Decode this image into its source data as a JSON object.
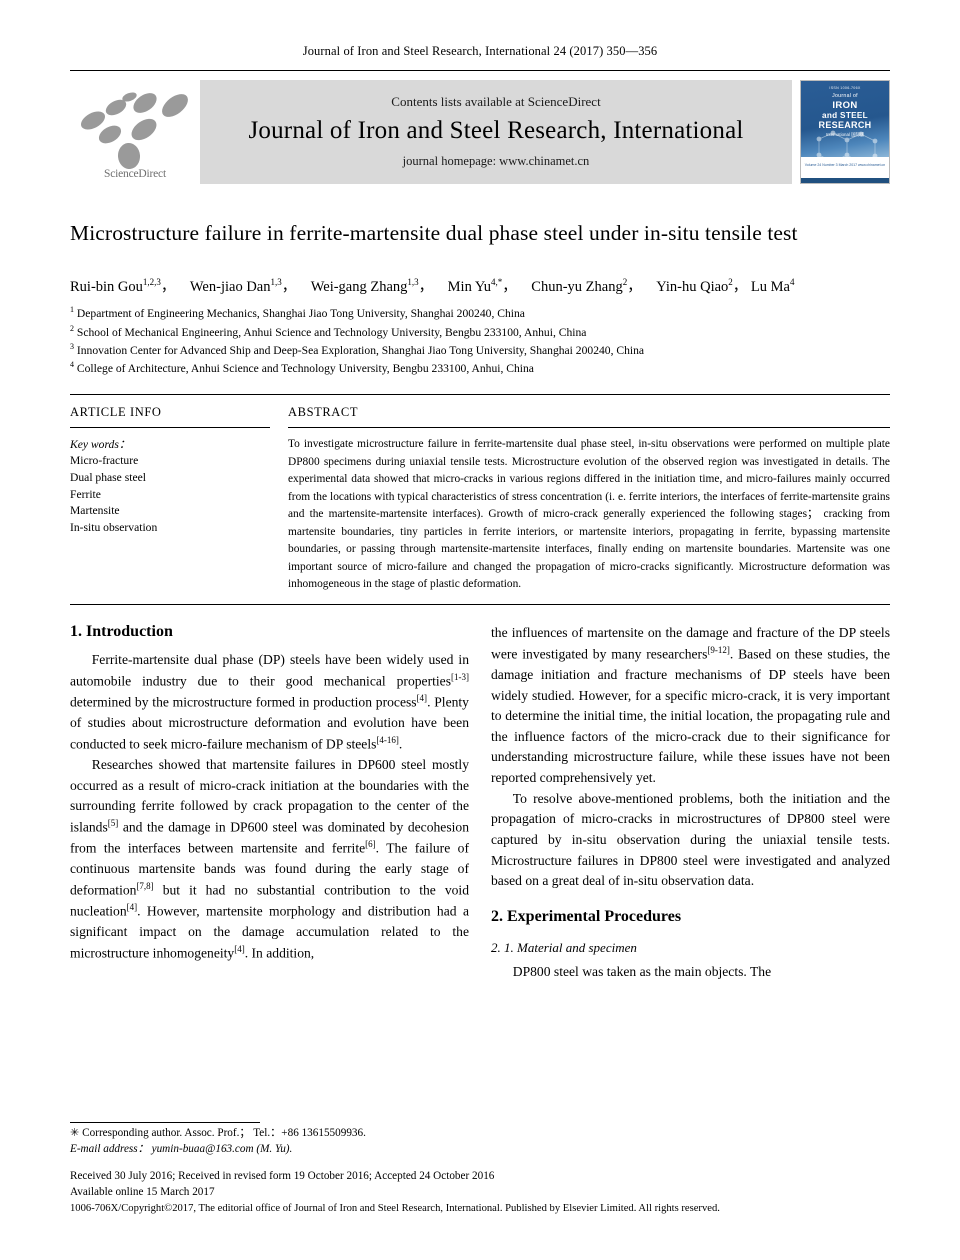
{
  "running_head": "Journal of Iron and Steel Research, International 24 (2017) 350—356",
  "masthead": {
    "sciencedirect_label": "ScienceDirect",
    "contents_line": "Contents lists available at ScienceDirect",
    "journal_title": "Journal of Iron and Steel Research, International",
    "homepage_line": "journal homepage: www.chinamet.cn",
    "cover": {
      "top_tiny": "ISSN 1006-706X",
      "journal_word": "Journal of",
      "iron": "IRON",
      "and_steel": "and STEEL",
      "research": "RESEARCH",
      "international": "International\n国际版",
      "badge": "Available online at\nwww.sciencedirect.com",
      "white_text": "Volume 24  Number 3  March 2017\nwww.chinamet.cn"
    }
  },
  "article": {
    "title": "Microstructure failure in ferrite-martensite dual phase steel under in-situ tensile test",
    "authors_html": "Rui-bin Gou<sup>1,2,3</sup>， Wen-jiao Dan<sup>1,3</sup>， Wei-gang Zhang<sup>1,3</sup>， Min Yu<sup>4,*</sup>， Chun-yu Zhang<sup>2</sup>， Yin-hu Qiao<sup>2</sup>， Lu Ma<sup>4</sup>",
    "affiliations": [
      "1 Department of Engineering Mechanics, Shanghai Jiao Tong University, Shanghai 200240, China",
      "2 School of Mechanical Engineering, Anhui Science and Technology University, Bengbu 233100, Anhui, China",
      "3 Innovation Center for Advanced Ship and Deep-Sea Exploration, Shanghai Jiao Tong University, Shanghai 200240, China",
      "4 College of Architecture, Anhui Science and Technology University, Bengbu 233100, Anhui, China"
    ]
  },
  "article_info": {
    "heading": "ARTICLE INFO",
    "keywords_label": "Key words：",
    "keywords": [
      "Micro-fracture",
      "Dual phase steel",
      "Ferrite",
      "Martensite",
      "In-situ observation"
    ]
  },
  "abstract": {
    "heading": "ABSTRACT",
    "text": "To investigate microstructure failure in ferrite-martensite dual phase steel, in-situ observations were performed on multiple plate DP800 specimens during uniaxial tensile tests. Microstructure evolution of the observed region was investigated in details. The experimental data showed that micro-cracks in various regions differed in the initiation time, and micro-failures mainly occurred from the locations with typical characteristics of stress concentration (i. e. ferrite interiors, the interfaces of ferrite-martensite grains and the martensite-martensite interfaces). Growth of micro-crack generally experienced the following stages； cracking from martensite boundaries, tiny particles in ferrite interiors, or martensite interiors, propagating in ferrite, bypassing martensite boundaries, or passing through martensite-martensite interfaces, finally ending on martensite boundaries. Martensite was one important source of micro-failure and changed the propagation of micro-cracks significantly. Microstructure deformation was inhomogeneous in the stage of plastic deformation."
  },
  "body": {
    "section1_heading": "1. Introduction",
    "col1_para1_html": "Ferrite-martensite dual phase (DP) steels have been widely used in automobile industry due to their good mechanical properties<sup>[1-3]</sup> determined by the microstructure formed in production process<sup>[4]</sup>. Plenty of studies about microstructure deformation and evolution have been conducted to seek micro-failure mechanism of DP steels<sup>[4-16]</sup>.",
    "col1_para2_html": "Researches showed that martensite failures in DP600 steel mostly occurred as a result of micro-crack initiation at the boundaries with the surrounding ferrite followed by crack propagation to the center of the islands<sup>[5]</sup> and the damage in DP600 steel was dominated by decohesion from the interfaces between martensite and ferrite<sup>[6]</sup>. The failure of continuous martensite bands was found during the early stage of deformation<sup>[7,8]</sup> but it had no substantial contribution to the void nucleation<sup>[4]</sup>. However, martensite morphology and distribution had a significant impact on the damage accumulation related to the microstructure inhomogeneity<sup>[4]</sup>. In addition,",
    "col2_para1_html": "the influences of martensite on the damage and fracture of the DP steels were investigated by many researchers<sup>[9-12]</sup>. Based on these studies, the damage initiation and fracture mechanisms of DP steels have been widely studied. However, for a specific micro-crack, it is very important to determine the initial time, the initial location, the propagating rule and the influence factors of the micro-crack due to their significance for understanding microstructure failure, while these issues have not been reported comprehensively yet.",
    "col2_para2_html": "To resolve above-mentioned problems, both the initiation and the propagation of micro-cracks in microstructures of DP800 steel were captured by in-situ observation during the uniaxial tensile tests. Microstructure failures in DP800 steel were investigated and analyzed based on a great deal of in-situ observation data.",
    "section2_heading": "2. Experimental Procedures",
    "subsection21_heading": "2. 1. Material and specimen",
    "col2_para3_html": "DP800 steel was taken as the main objects. The"
  },
  "footer": {
    "corresponding_author": "✳ Corresponding author. Assoc. Prof.； Tel.：+86 13615509936.",
    "email_line": "E-mail address： yumin-buaa@163.com (M. Yu).",
    "history": "Received 30 July 2016; Received in revised form 19 October 2016; Accepted 24 October 2016",
    "available_online": "Available online 15 March 2017",
    "copyright": "1006-706X/Copyright©2017, The editorial office of Journal of Iron and Steel Research, International. Published by Elsevier Limited. All rights reserved."
  },
  "colors": {
    "masthead_band": "#d9d9d9",
    "cover_blue": "#2a5d96",
    "logo_gray": "#9a9a9a"
  }
}
